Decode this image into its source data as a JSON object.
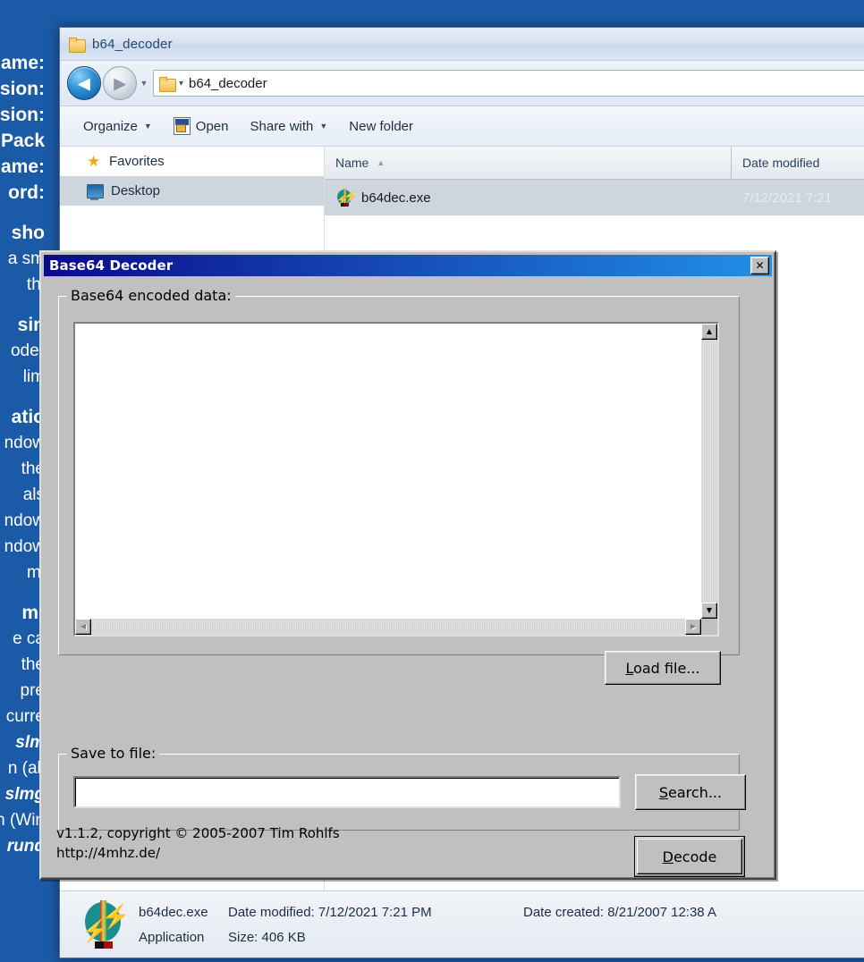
{
  "background_document": {
    "lines": [
      {
        "text": "lame:",
        "style": "h"
      },
      {
        "text": "sion:",
        "style": "h"
      },
      {
        "text": "rsion:",
        "style": "h"
      },
      {
        "text": "e Pack",
        "style": "h"
      },
      {
        "text": "lame:",
        "style": "h"
      },
      {
        "text": "ord:",
        "style": "h"
      },
      {
        "text": "",
        "style": "sp"
      },
      {
        "text": "sho",
        "style": "h"
      },
      {
        "text": "a sm",
        "style": "p"
      },
      {
        "text": "thi",
        "style": "p"
      },
      {
        "text": "",
        "style": "sp"
      },
      {
        "text": "sin",
        "style": "h"
      },
      {
        "text": "oder",
        "style": "p"
      },
      {
        "text": "lim",
        "style": "p"
      },
      {
        "text": "",
        "style": "sp"
      },
      {
        "text": "atio",
        "style": "h"
      },
      {
        "text": "ndow",
        "style": "p"
      },
      {
        "text": "the",
        "style": "p"
      },
      {
        "text": "als",
        "style": "p"
      },
      {
        "text": "ndow",
        "style": "p"
      },
      {
        "text": "ndow",
        "style": "p"
      },
      {
        "text": "mi",
        "style": "p"
      },
      {
        "text": "",
        "style": "sp"
      },
      {
        "text": "m:",
        "style": "h"
      },
      {
        "text": "e ca",
        "style": "p"
      },
      {
        "text": "the",
        "style": "p"
      },
      {
        "text": "pre",
        "style": "p"
      },
      {
        "text": "curre",
        "style": "p"
      },
      {
        "text": "slm",
        "style": "i"
      },
      {
        "text": "n (all",
        "style": "p"
      },
      {
        "text": "slmg",
        "style": "i"
      },
      {
        "text": "n (Win",
        "style": "p"
      },
      {
        "text": "rund",
        "style": "i"
      }
    ]
  },
  "explorer": {
    "title": "b64_decoder",
    "address": "b64_decoder",
    "nav": {
      "back_icon": "back-arrow-icon",
      "forward_icon": "forward-arrow-icon",
      "history_icon": "chevron-down-icon",
      "back_glyph": "◀",
      "forward_glyph": "▶",
      "history_glyph": "▼",
      "separator_glyph": "▾"
    },
    "toolbar": [
      {
        "label": "Organize",
        "caret": "▼",
        "icon": ""
      },
      {
        "label": "Open",
        "caret": "",
        "icon": "open-file-icon"
      },
      {
        "label": "Share with",
        "caret": "▼",
        "icon": ""
      },
      {
        "label": "New folder",
        "caret": "",
        "icon": ""
      }
    ],
    "sidebar": [
      {
        "label": "Favorites",
        "icon": "star-icon",
        "glyph": "★",
        "shaded": false
      },
      {
        "label": "Desktop",
        "icon": "desktop-icon",
        "glyph": "",
        "shaded": true
      }
    ],
    "columns": [
      {
        "label": "Name",
        "sort": "▲"
      },
      {
        "label": "Date modified",
        "sort": ""
      }
    ],
    "files": [
      {
        "name": "b64dec.exe",
        "date_modified": "7/12/2021 7:21",
        "icon": "b64dec-app-icon"
      }
    ],
    "status": {
      "file_name": "b64dec.exe",
      "date_modified_label": "Date modified: 7/12/2021 7:21 PM",
      "date_created_label": "Date created: 8/21/2007 12:38 A",
      "type": "Application",
      "size": "Size: 406 KB"
    }
  },
  "dialog": {
    "title": "Base64 Decoder",
    "close_label": "✕",
    "input_group_label": "Base64 encoded data:",
    "input_value": "",
    "save_group_label": "Save to file:",
    "save_value": "",
    "buttons": {
      "load_file": {
        "pre": "",
        "accel": "L",
        "post": "oad file..."
      },
      "search": {
        "pre": "",
        "accel": "S",
        "post": "earch..."
      },
      "decode": {
        "pre": "",
        "accel": "D",
        "post": "ecode"
      }
    },
    "scrollbar": {
      "up_glyph": "▲",
      "down_glyph": "▼",
      "left_glyph": "◀",
      "right_glyph": "▶"
    },
    "about_line1": "v1.1.2, copyright © 2005-2007 Tim Rohlfs",
    "about_line2": "http://4mhz.de/"
  }
}
